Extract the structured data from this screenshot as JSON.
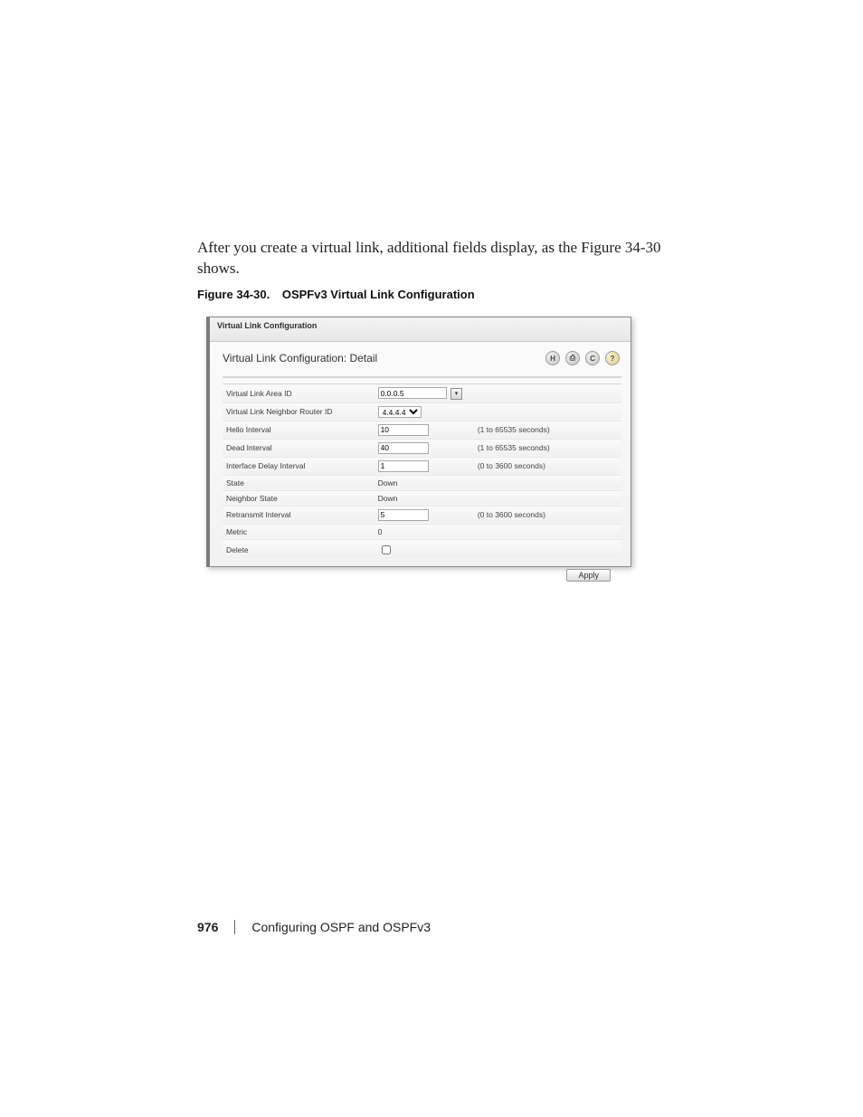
{
  "intro_text_1": "After you create a virtual link, additional fields display, as the Figure 34-30",
  "intro_text_2": "shows.",
  "figure_label_num": "Figure 34-30.",
  "figure_label_title": "OSPFv3 Virtual Link Configuration",
  "panel": {
    "window_title": "Virtual Link Configuration",
    "detail_title": "Virtual Link Configuration: Detail",
    "icons": {
      "save": "H",
      "print": "⎙",
      "refresh": "C",
      "help": "?"
    },
    "rows": {
      "area_id": {
        "label": "Virtual Link Area ID",
        "value": "0.0.0.5",
        "has_dropdown": true
      },
      "neighbor_id": {
        "label": "Virtual Link Neighbor Router ID",
        "value": "4.4.4.4"
      },
      "hello_interval": {
        "label": "Hello Interval",
        "value": "10",
        "hint": "(1 to 65535 seconds)"
      },
      "dead_interval": {
        "label": "Dead Interval",
        "value": "40",
        "hint": "(1 to 65535 seconds)"
      },
      "iface_delay": {
        "label": "Interface Delay Interval",
        "value": "1",
        "hint": "(0 to 3600 seconds)"
      },
      "state": {
        "label": "State",
        "value": "Down"
      },
      "neighbor_state": {
        "label": "Neighbor State",
        "value": "Down"
      },
      "retransmit": {
        "label": "Retransmit Interval",
        "value": "5",
        "hint": "(0 to 3600 seconds)"
      },
      "metric": {
        "label": "Metric",
        "value": "0"
      },
      "delete": {
        "label": "Delete"
      }
    },
    "apply_label": "Apply"
  },
  "footer": {
    "page_num": "976",
    "section": "Configuring OSPF and OSPFv3"
  }
}
